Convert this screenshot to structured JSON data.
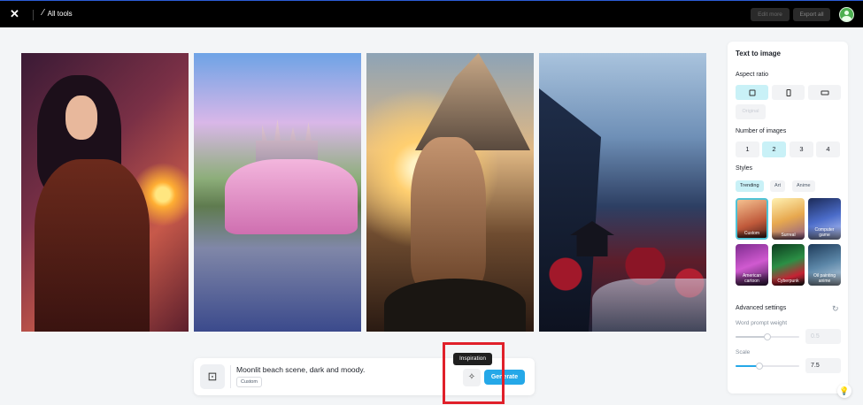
{
  "topbar": {
    "logo_icon": "capcut-logo-icon",
    "all_tools_label": "All tools",
    "edit_more_label": "Edit more",
    "export_all_label": "Export all"
  },
  "gallery": {
    "images": [
      {
        "subject": "armored-woman-portrait"
      },
      {
        "subject": "pink-car-castle"
      },
      {
        "subject": "cat-mountain-sunset"
      },
      {
        "subject": "misty-valley-pagoda"
      }
    ]
  },
  "prompt": {
    "text": "Moonlit beach scene, dark and moody.",
    "style_tag": "Custom",
    "inspiration_tooltip": "Inspiration",
    "generate_label": "Generate"
  },
  "panel": {
    "title": "Text to image",
    "aspect_ratio_label": "Aspect ratio",
    "aspect_ratio_more": "Original",
    "number_label": "Number of images",
    "numbers": [
      "1",
      "2",
      "3",
      "4"
    ],
    "selected_number": "2",
    "styles_label": "Styles",
    "style_tabs": [
      "Trending",
      "Art",
      "Anime"
    ],
    "style_cards": [
      "Custom",
      "Surreal",
      "Computer game",
      "American cartoon",
      "Cyberpunk",
      "Oil painting anime"
    ],
    "advanced_label": "Advanced settings",
    "word_weight_label": "Word prompt weight",
    "word_weight_value": "0.5",
    "scale_label": "Scale",
    "scale_value": "7.5"
  },
  "colors": {
    "accent": "#25a8e8",
    "selected_bg": "#c9f1f7",
    "highlight": "#e0202a"
  }
}
